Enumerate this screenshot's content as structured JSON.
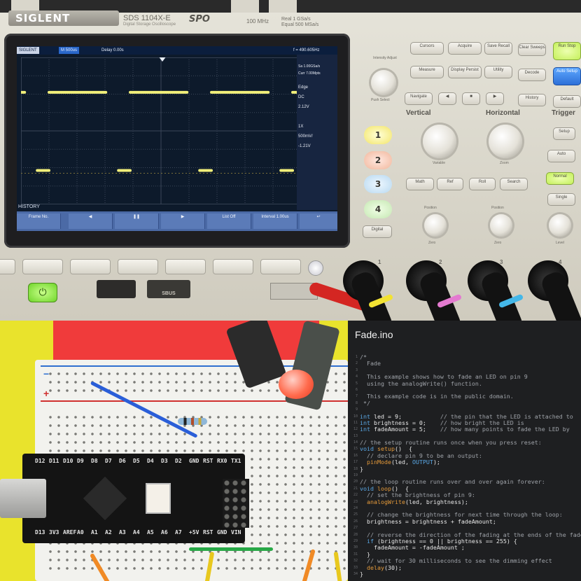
{
  "scope": {
    "brand": "SIGLENT",
    "model": "SDS 1104X-E",
    "model_sub": "Digital Storage Oscilloscope",
    "model_logo": "SPO",
    "spec_bandwidth": "100 MHz",
    "spec_rate_1": "Real  1 GSa/s",
    "spec_rate_2": "Equal  500 MSa/s",
    "status": {
      "mode": "SIGLENT",
      "timebase": "M 500us",
      "delay": "Delay 0.00s",
      "freq": "f = 490.605Hz",
      "sample_rate": "Sa 1.00GSa/s",
      "memory": "Curr 7.00Mpts"
    },
    "side_panel": [
      "Edge",
      "DC",
      "2.12V",
      "1X",
      "500mV/",
      "-1.21V"
    ],
    "history_label": "HISTORY",
    "softkeys": [
      "Frame No.",
      "",
      "",
      "",
      "List Off",
      "Interval 1.00us",
      ""
    ],
    "buttons": {
      "cursors": "Cursors",
      "acquire": "Acquire",
      "save_recall": "Save Recall",
      "clear_sweeps": "Clear Sweeps",
      "run_stop": "Run Stop",
      "measure": "Measure",
      "display_persist": "Display Persist",
      "utility": "Utility",
      "decode": "Decode",
      "auto_setup": "Auto Setup",
      "navigate": "Navigate",
      "history": "History",
      "default": "Default",
      "math": "Math",
      "ref": "Ref",
      "roll": "Roll",
      "search": "Search",
      "digital": "Digital",
      "setup": "Setup",
      "auto": "Auto",
      "normal": "Normal",
      "single": "Single",
      "intensity": "Intensity Adjust",
      "push_select": "Push Select"
    },
    "sections": {
      "vertical": "Vertical",
      "horizontal": "Horizontal",
      "trigger": "Trigger"
    },
    "knob_labels": {
      "variable": "Variable",
      "zoom": "Zoom",
      "position_v": "Position",
      "position_h": "Position",
      "zero_v": "Zero",
      "zero_h": "Zero",
      "level": "Level"
    },
    "channels": [
      "1",
      "2",
      "3",
      "4"
    ],
    "bnc_labels": [
      "1",
      "2",
      "3",
      "4"
    ],
    "sbus": "SBUS"
  },
  "waveform": {
    "duty_cycle": 0.7,
    "period_divs": 2.9,
    "high_level_div": 2.1,
    "low_level_div": -2.15
  },
  "board": {
    "plus": "+",
    "minus": "−",
    "arduino_top_pins": [
      "D12",
      "D11",
      "D10",
      "D9",
      "D8",
      "D7",
      "D6",
      "D5",
      "D4",
      "D3",
      "D2",
      "GND",
      "RST",
      "RX0",
      "TX1"
    ],
    "arduino_bottom_pins": [
      "D13",
      "3V3",
      "AREF",
      "A0",
      "A1",
      "A2",
      "A3",
      "A4",
      "A5",
      "A6",
      "A7",
      "+5V",
      "RST",
      "GND",
      "VIN"
    ]
  },
  "editor": {
    "title": "Fade.ino",
    "lines": [
      {
        "n": "1",
        "t": "/*",
        "c": "cm"
      },
      {
        "n": "2",
        "t": "  Fade",
        "c": "cm"
      },
      {
        "n": "3",
        "t": "",
        "c": "cm"
      },
      {
        "n": "4",
        "t": "  This example shows how to fade an LED on pin 9",
        "c": "cm"
      },
      {
        "n": "5",
        "t": "  using the analogWrite() function.",
        "c": "cm"
      },
      {
        "n": "6",
        "t": "",
        "c": "cm"
      },
      {
        "n": "7",
        "t": "  This example code is in the public domain.",
        "c": "cm"
      },
      {
        "n": "8",
        "t": " */",
        "c": "cm"
      },
      {
        "n": "9",
        "t": "",
        "c": ""
      },
      {
        "n": "10",
        "t": "int led = 9;           // the pin that the LED is attached to",
        "c": "mix1"
      },
      {
        "n": "11",
        "t": "int brightness = 0;    // how bright the LED is",
        "c": "mix1"
      },
      {
        "n": "12",
        "t": "int fadeAmount = 5;    // how many points to fade the LED by",
        "c": "mix1"
      },
      {
        "n": "13",
        "t": "",
        "c": ""
      },
      {
        "n": "14",
        "t": "// the setup routine runs once when you press reset:",
        "c": "cm"
      },
      {
        "n": "15",
        "t": "void setup()  {",
        "c": "kw"
      },
      {
        "n": "16",
        "t": "  // declare pin 9 to be an output:",
        "c": "cm"
      },
      {
        "n": "17",
        "t": "  pinMode(led, OUTPUT);",
        "c": "fn"
      },
      {
        "n": "18",
        "t": "}",
        "c": ""
      },
      {
        "n": "19",
        "t": "",
        "c": ""
      },
      {
        "n": "20",
        "t": "// the loop routine runs over and over again forever:",
        "c": "cm"
      },
      {
        "n": "21",
        "t": "void loop()  {",
        "c": "kw"
      },
      {
        "n": "22",
        "t": "  // set the brightness of pin 9:",
        "c": "cm"
      },
      {
        "n": "23",
        "t": "  analogWrite(led, brightness);",
        "c": "fn"
      },
      {
        "n": "24",
        "t": "",
        "c": ""
      },
      {
        "n": "25",
        "t": "  // change the brightness for next time through the loop:",
        "c": "cm"
      },
      {
        "n": "26",
        "t": "  brightness = brightness + fadeAmount;",
        "c": ""
      },
      {
        "n": "27",
        "t": "",
        "c": ""
      },
      {
        "n": "28",
        "t": "  // reverse the direction of the fading at the ends of the fade:",
        "c": "cm"
      },
      {
        "n": "29",
        "t": "  if (brightness == 0 || brightness == 255) {",
        "c": "kw2"
      },
      {
        "n": "30",
        "t": "    fadeAmount = -fadeAmount ;",
        "c": ""
      },
      {
        "n": "31",
        "t": "  }",
        "c": ""
      },
      {
        "n": "32",
        "t": "  // wait for 30 milliseconds to see the dimming effect",
        "c": "cm"
      },
      {
        "n": "33",
        "t": "  delay(30);",
        "c": "fn"
      },
      {
        "n": "34",
        "t": "}",
        "c": ""
      }
    ]
  },
  "colors": {
    "trace_yellow": "#f1ef7a",
    "screen_bg": "#0d1a2b",
    "editor_bg": "#1e1f21",
    "comment": "#9ea2a8",
    "keyword": "#5aa8e6",
    "function": "#e59a3a"
  }
}
